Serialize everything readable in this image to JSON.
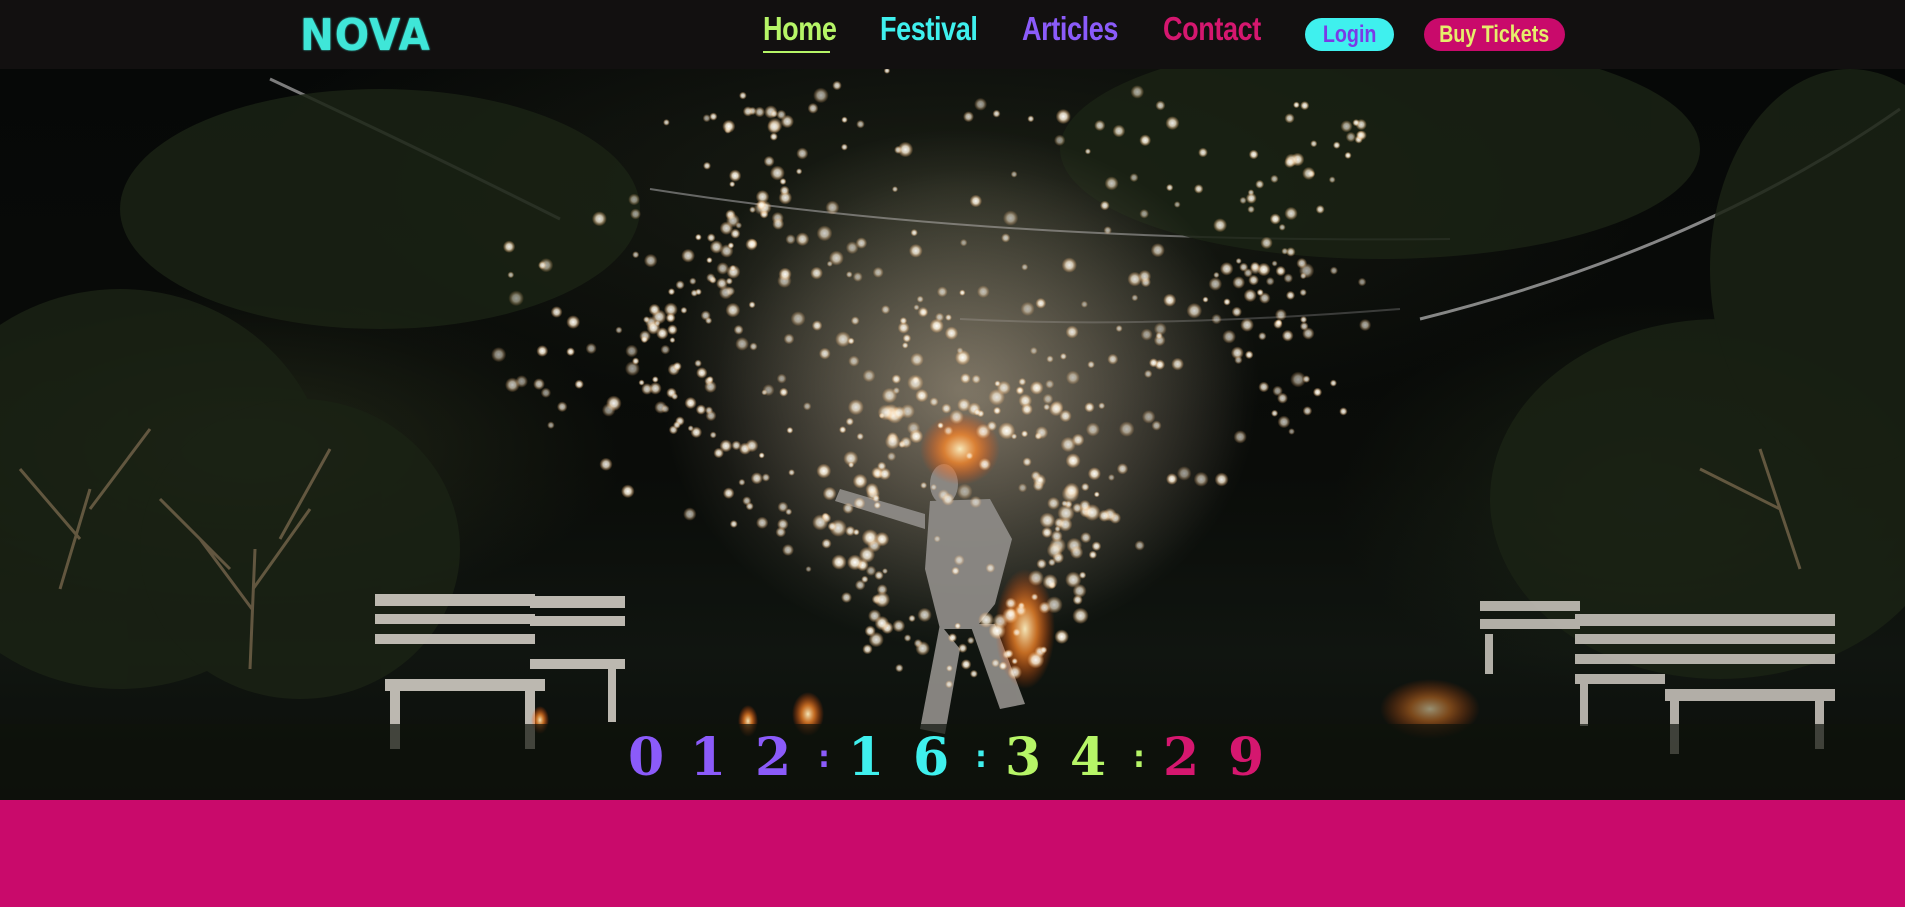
{
  "brand": {
    "logo": "NOVA",
    "colors": {
      "lime": "#b6f567",
      "cyan": "#3ff0ee",
      "purple": "#8b5bfa",
      "pink": "#d5176f",
      "magenta_bg": "#c90a6b"
    }
  },
  "nav": {
    "links": [
      {
        "label": "Home",
        "active": true
      },
      {
        "label": "Festival",
        "active": false
      },
      {
        "label": "Articles",
        "active": false
      },
      {
        "label": "Contact",
        "active": false
      }
    ],
    "login_label": "Login",
    "tickets_label": "Buy Tickets"
  },
  "hero": {
    "image_subject": "fire performer with sparklers at night",
    "countdown": {
      "days": [
        "0",
        "1",
        "2"
      ],
      "hours": [
        "1",
        "6"
      ],
      "minutes": [
        "3",
        "4"
      ],
      "seconds": [
        "2",
        "9"
      ],
      "separator": ":"
    }
  }
}
